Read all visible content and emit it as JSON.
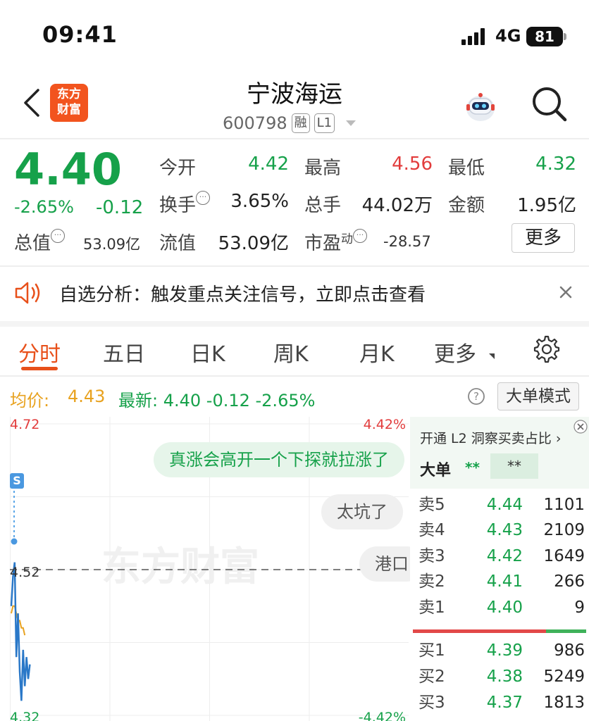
{
  "status_bar": {
    "time": "09:41",
    "network": "4G",
    "battery": "81"
  },
  "header": {
    "logo_line1": "东方",
    "logo_line2": "财富",
    "title": "宁波海运",
    "code": "600798",
    "tag1": "融",
    "tag2": "L1"
  },
  "quote": {
    "price": "4.40",
    "change_pct": "-2.65%",
    "change_abs": "-0.12",
    "fields": {
      "open_label": "今开",
      "open_value": "4.42",
      "high_label": "最高",
      "high_value": "4.56",
      "low_label": "最低",
      "low_value": "4.32",
      "turnover_label": "换手",
      "turnover_value": "3.65%",
      "volume_label": "总手",
      "volume_value": "44.02万",
      "amount_label": "金额",
      "amount_value": "1.95亿",
      "mktcap_label": "总值",
      "mktcap_value": "53.09亿",
      "float_label": "流值",
      "float_value": "53.09亿",
      "pe_label": "市盈",
      "pe_sup": "动",
      "pe_value": "-28.57"
    },
    "more_button": "更多"
  },
  "notice": {
    "text": "自选分析：触发重点关注信号，立即点击查看"
  },
  "tabs": [
    "分时",
    "五日",
    "日K",
    "周K",
    "月K",
    "更多"
  ],
  "chart_header": {
    "avg_label": "均价:",
    "avg_value": "4.43",
    "latest": "最新:  4.40   -0.12   -2.65%",
    "mode_button": "大单模式"
  },
  "chart": {
    "y_top": "4.72",
    "y_mid": "4.52",
    "y_bottom": "4.32",
    "pct_top": "4.42%",
    "pct_bottom": "-4.42%",
    "s_marker": "S",
    "watermark": "东方财富",
    "bubbles": [
      "真涨会高开一个下探就拉涨了",
      "太坑了",
      "港口"
    ]
  },
  "chart_data": {
    "type": "line",
    "y_labels": [
      "4.72",
      "4.52",
      "4.32"
    ],
    "right_labels": [
      "4.42%",
      "-4.42%"
    ],
    "ylim": [
      4.32,
      4.72
    ],
    "reference": 4.52,
    "series": [
      {
        "values": [
          4.47,
          4.51,
          4.53,
          4.4,
          4.46,
          4.38,
          4.34,
          4.41,
          4.36,
          4.4,
          4.37,
          4.39
        ]
      },
      {
        "values": [
          4.46,
          4.47,
          4.47,
          4.46,
          4.45,
          4.45,
          4.44,
          4.44,
          4.43
        ]
      }
    ]
  },
  "order_book": {
    "promo": "开通 L2 洞察买卖占比",
    "big_label": "大单",
    "big_val1": "**",
    "big_val2": "**",
    "asks": [
      {
        "name": "卖5",
        "price": "4.44",
        "vol": "1101"
      },
      {
        "name": "卖4",
        "price": "4.43",
        "vol": "2109"
      },
      {
        "name": "卖3",
        "price": "4.42",
        "vol": "1649"
      },
      {
        "name": "卖2",
        "price": "4.41",
        "vol": "266"
      },
      {
        "name": "卖1",
        "price": "4.40",
        "vol": "9"
      }
    ],
    "bids": [
      {
        "name": "买1",
        "price": "4.39",
        "vol": "986"
      },
      {
        "name": "买2",
        "price": "4.38",
        "vol": "5249"
      },
      {
        "name": "买3",
        "price": "4.37",
        "vol": "1813"
      }
    ],
    "sell_ratio": 0.77
  },
  "colors": {
    "up": "#e23c3c",
    "down": "#16a14a",
    "accent": "#e8501a",
    "avg_line": "#e8a21f",
    "price_line": "#2a78c8"
  }
}
